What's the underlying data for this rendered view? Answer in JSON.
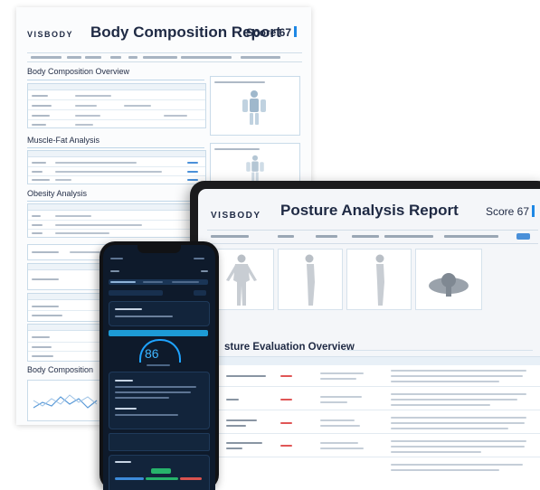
{
  "paper": {
    "brand": "VISBODY",
    "title": "Body Composition Report",
    "score": "Score 67",
    "sections": [
      "Body Composition Overview",
      "Muscle-Fat Analysis",
      "Obesity Analysis",
      "Body Composition"
    ]
  },
  "tablet": {
    "brand": "VISBODY",
    "title": "Posture Analysis Report",
    "score": "Score 67",
    "section": "sture Evaluation Overview"
  },
  "phone": {
    "score": "86"
  },
  "colors": {
    "accent": "#1e88e5",
    "navy_text": "#1f2a44",
    "phone_bg": "#0e1a2b",
    "gauge": "#1ea3ff"
  }
}
